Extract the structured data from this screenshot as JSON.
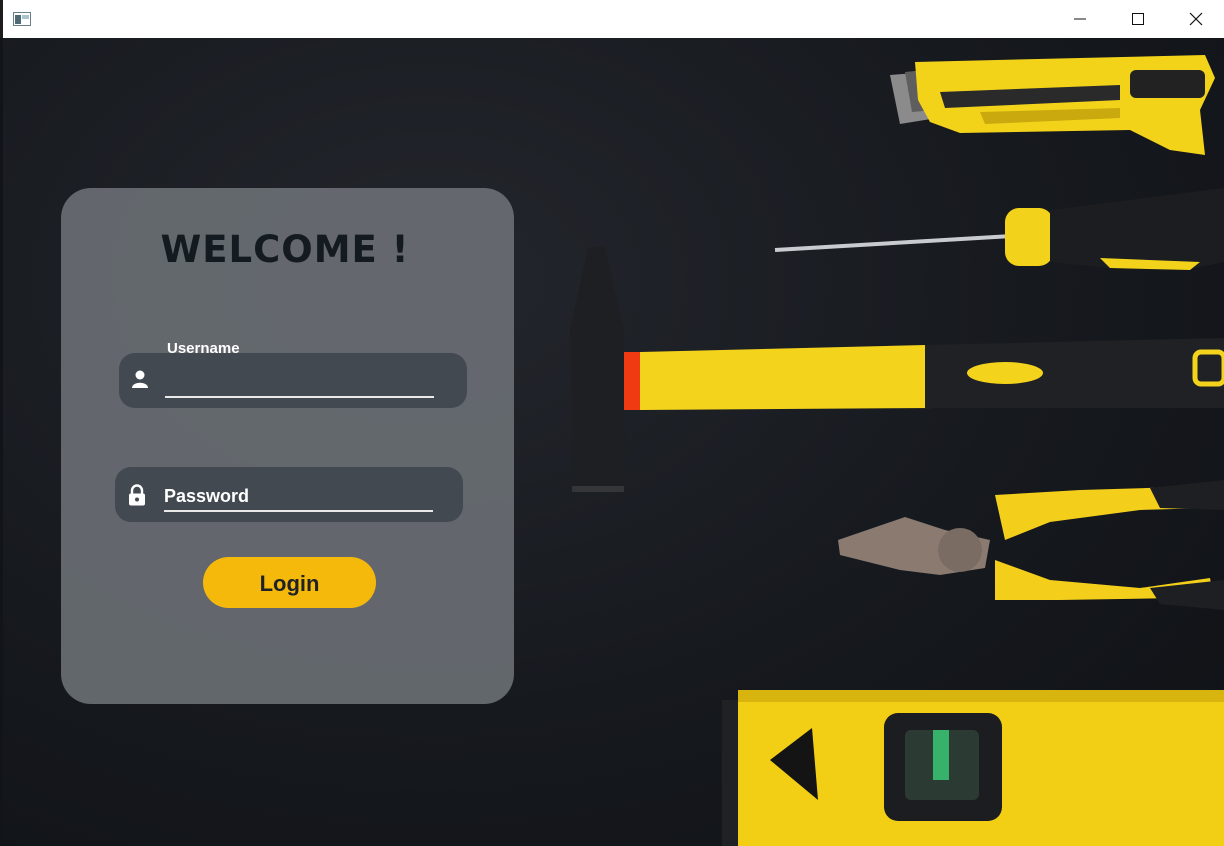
{
  "window": {
    "controls": [
      "minimize-icon",
      "maximize-icon",
      "close-icon"
    ]
  },
  "login": {
    "title": "WELCOME !",
    "username_label": "Username",
    "username_value": "",
    "password_placeholder": "Password",
    "login_label": "Login"
  },
  "colors": {
    "accent": "#f5b90c",
    "card": "#6d7278",
    "field": "#434950",
    "background": "#16191e"
  },
  "icons": {
    "username": "user-icon",
    "password": "lock-icon"
  }
}
